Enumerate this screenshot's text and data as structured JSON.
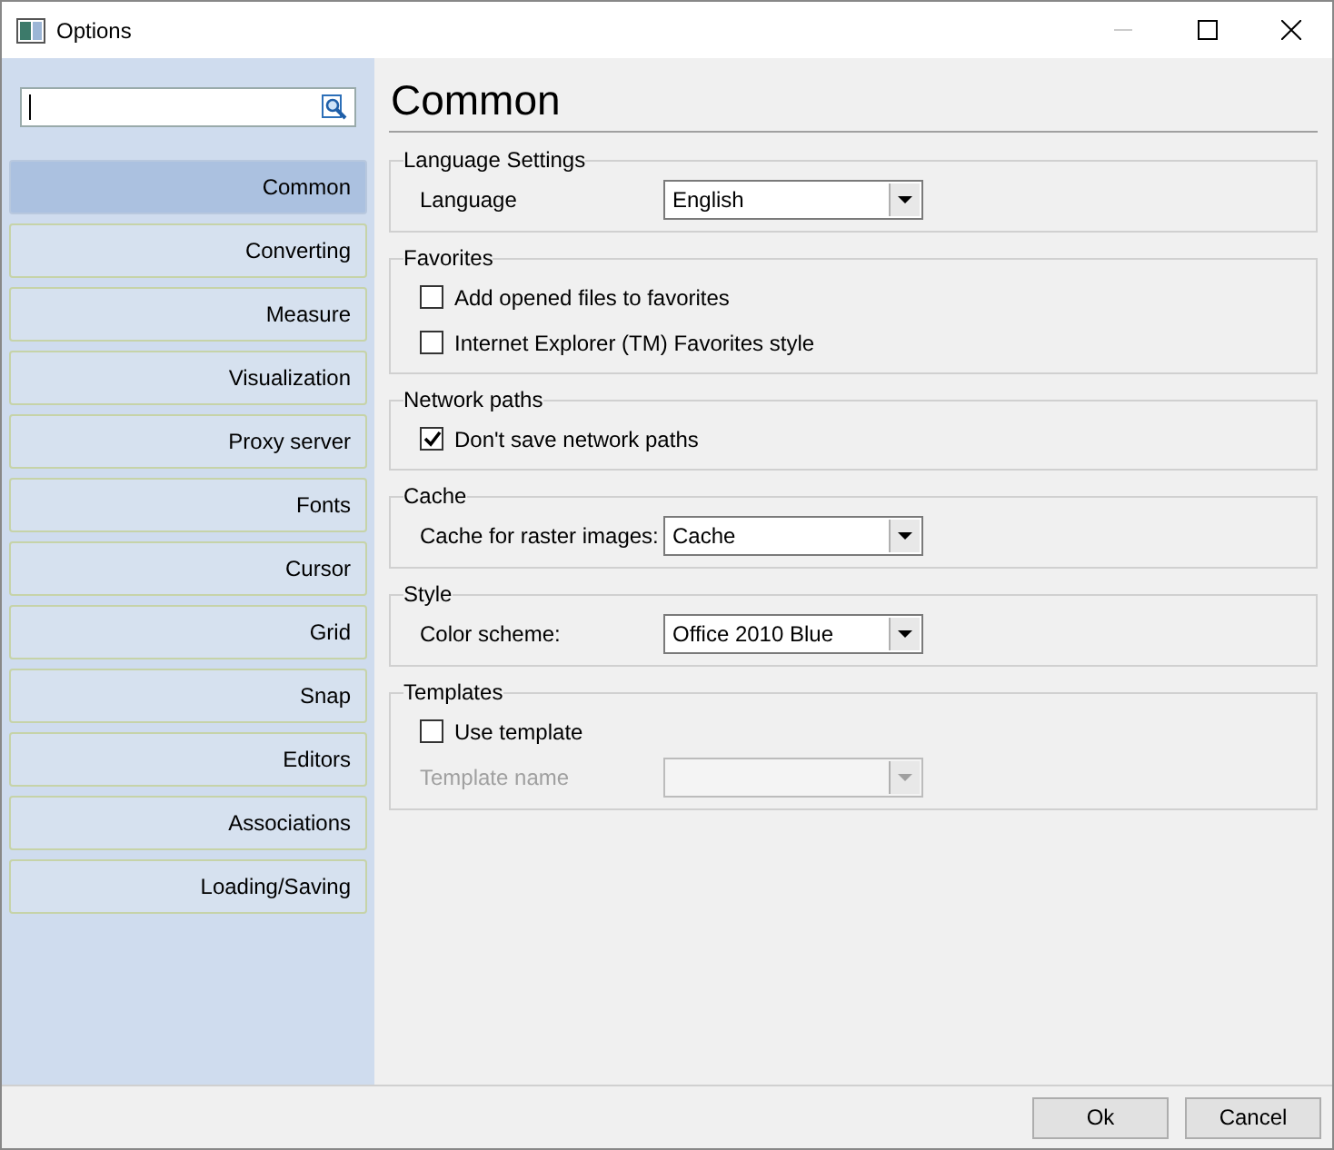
{
  "window": {
    "title": "Options"
  },
  "search": {
    "cursor": true
  },
  "sidebar": {
    "items": [
      {
        "label": "Common",
        "selected": true
      },
      {
        "label": "Converting",
        "selected": false
      },
      {
        "label": "Measure",
        "selected": false
      },
      {
        "label": "Visualization",
        "selected": false
      },
      {
        "label": "Proxy server",
        "selected": false
      },
      {
        "label": "Fonts",
        "selected": false
      },
      {
        "label": "Cursor",
        "selected": false
      },
      {
        "label": "Grid",
        "selected": false
      },
      {
        "label": "Snap",
        "selected": false
      },
      {
        "label": "Editors",
        "selected": false
      },
      {
        "label": "Associations",
        "selected": false
      },
      {
        "label": "Loading/Saving",
        "selected": false
      }
    ]
  },
  "page": {
    "title": "Common",
    "groups": [
      {
        "title": "Language Settings",
        "rows": [
          {
            "kind": "select",
            "label": "Language",
            "value": "English",
            "disabled": false
          }
        ]
      },
      {
        "title": "Favorites",
        "rows": [
          {
            "kind": "checkbox",
            "label": "Add opened files to favorites",
            "checked": false
          },
          {
            "kind": "checkbox",
            "label": "Internet Explorer (TM) Favorites style",
            "checked": false
          }
        ]
      },
      {
        "title": "Network paths",
        "rows": [
          {
            "kind": "checkbox",
            "label": "Don't save network paths",
            "checked": true
          }
        ]
      },
      {
        "title": "Cache",
        "rows": [
          {
            "kind": "select",
            "label": "Cache for raster images:",
            "value": "Cache",
            "disabled": false
          }
        ]
      },
      {
        "title": "Style",
        "rows": [
          {
            "kind": "select",
            "label": "Color scheme:",
            "value": "Office 2010 Blue",
            "disabled": false
          }
        ]
      },
      {
        "title": "Templates",
        "rows": [
          {
            "kind": "checkbox",
            "label": "Use template",
            "checked": false
          },
          {
            "kind": "select",
            "label": "Template name",
            "disabled": true
          }
        ]
      }
    ]
  },
  "buttons": [
    "Ok",
    "Cancel"
  ]
}
